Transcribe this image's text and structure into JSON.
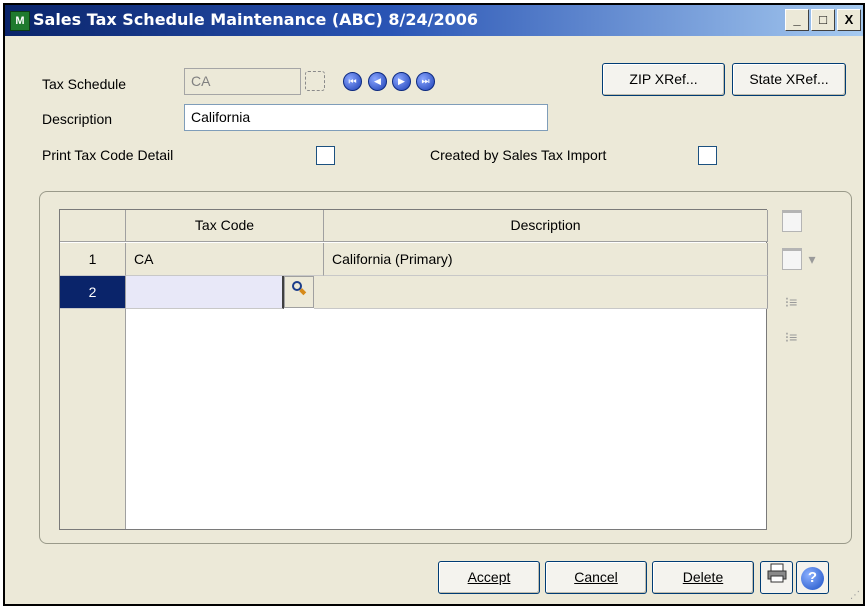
{
  "window": {
    "title": "Sales Tax Schedule Maintenance (ABC) 8/24/2006",
    "app_icon": "M",
    "controls": {
      "minimize": "_",
      "maximize": "□",
      "close": "X"
    }
  },
  "header": {
    "tax_schedule_label": "Tax Schedule",
    "tax_schedule_value": "CA",
    "description_label": "Description",
    "description_value": "California",
    "print_detail_label": "Print Tax Code Detail",
    "created_import_label": "Created by Sales Tax Import",
    "nav": {
      "first": "⏮",
      "prev": "◀",
      "next": "▶",
      "last": "⏭"
    },
    "zip_xref_label": "ZIP XRef...",
    "state_xref_label": "State XRef..."
  },
  "grid": {
    "columns": [
      "Tax Code",
      "Description"
    ],
    "rows": [
      {
        "num": "1",
        "tax_code": "CA",
        "description": "California (Primary)"
      },
      {
        "num": "2",
        "tax_code": "",
        "description": ""
      }
    ],
    "selected_row": "2"
  },
  "side_tools": {
    "insert": "▭",
    "append": "▭",
    "dropdown": "▾",
    "indent": "⁝≡",
    "outdent": "⁝≡"
  },
  "footer": {
    "accept_label": "Accept",
    "cancel_label": "Cancel",
    "delete_label": "Delete",
    "print_glyph": "🖶",
    "help_glyph": "?"
  },
  "colors": {
    "titlebar_start": "#0a246a",
    "titlebar_end": "#a6caf0",
    "selected_row": "#0a246a",
    "dialog_bg": "#ece9d8"
  }
}
